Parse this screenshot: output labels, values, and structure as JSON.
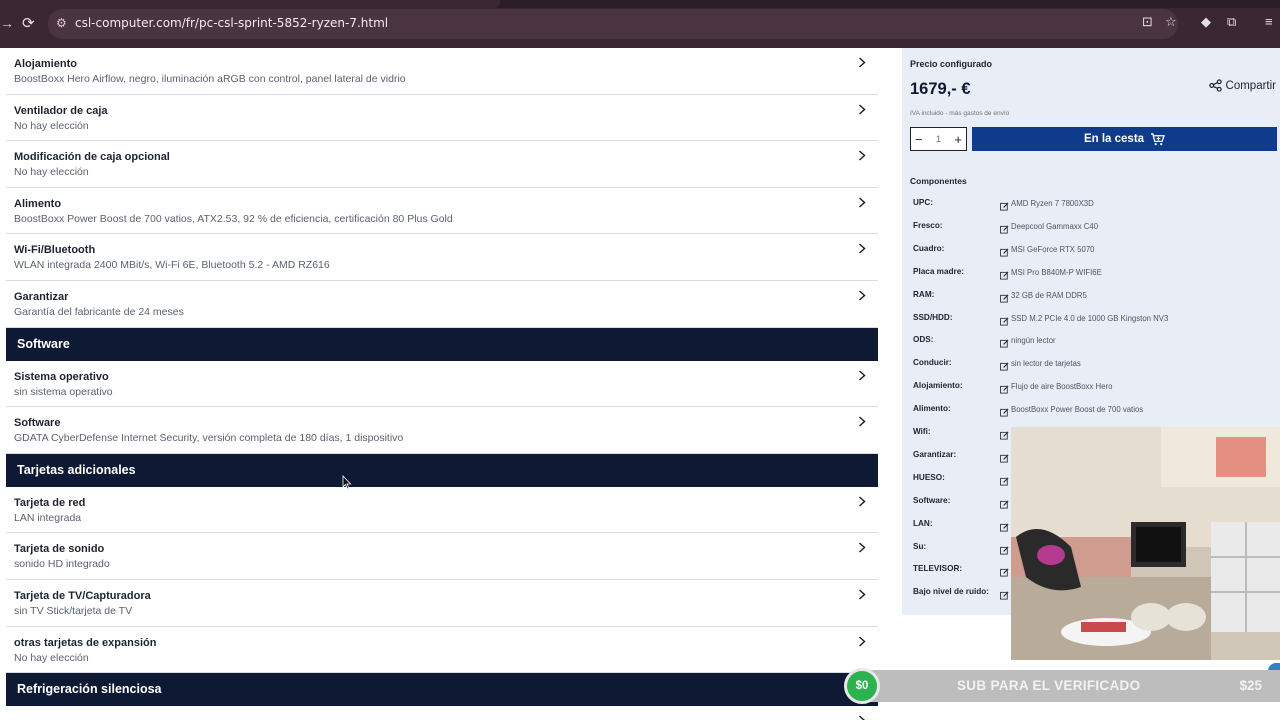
{
  "browser": {
    "url": "csl-computer.com/fr/pc-csl-sprint-5852-ryzen-7.html"
  },
  "sections": [
    {
      "heading": "",
      "rows": [
        {
          "title": "Alojamiento",
          "value": "BoostBoxx Hero Airflow, negro, iluminación aRGB con control, panel lateral de vidrio"
        },
        {
          "title": "Ventilador de caja",
          "value": "No hay elección"
        },
        {
          "title": "Modificación de caja opcional",
          "value": "No hay elección"
        },
        {
          "title": "Alimento",
          "value": "BoostBoxx Power Boost de 700 vatios, ATX2.53, 92 % de eficiencia, certificación 80 Plus Gold"
        },
        {
          "title": "Wi-Fi/Bluetooth",
          "value": "WLAN integrada 2400 MBit/s, Wi-Fi 6E, Bluetooth 5.2 - AMD RZ616"
        },
        {
          "title": "Garantizar",
          "value": "Garantía del fabricante de 24 meses"
        }
      ]
    },
    {
      "heading": "Software",
      "rows": [
        {
          "title": "Sistema operativo",
          "value": "sin sistema operativo"
        },
        {
          "title": "Software",
          "value": "GDATA CyberDefense Internet Security, versión completa de 180 días, 1 dispositivo"
        }
      ]
    },
    {
      "heading": "Tarjetas adicionales",
      "rows": [
        {
          "title": "Tarjeta de red",
          "value": "LAN integrada"
        },
        {
          "title": "Tarjeta de sonido",
          "value": "sonido HD integrado"
        },
        {
          "title": "Tarjeta de TV/Capturadora",
          "value": "sin TV Stick/tarjeta de TV"
        },
        {
          "title": "otras tarjetas de expansión",
          "value": "No hay elección"
        }
      ]
    },
    {
      "heading": "Refrigeración silenciosa",
      "rows": []
    }
  ],
  "panel": {
    "price_label": "Precio configurado",
    "price": "1679,- €",
    "vat_note": "IVA incluido - más gastos de envío",
    "share_label": "Compartir",
    "quantity": "1",
    "cart_label": "En la cesta",
    "components_title": "Componentes",
    "components": [
      {
        "key": "UPC:",
        "value": "AMD Ryzen 7 7800X3D"
      },
      {
        "key": "Fresco:",
        "value": "Deepcool Gammaxx C40"
      },
      {
        "key": "Cuadro:",
        "value": "MSI GeForce RTX 5070"
      },
      {
        "key": "Placa madre:",
        "value": "MSI Pro B840M-P WIFI6E"
      },
      {
        "key": "RAM:",
        "value": "32 GB de RAM DDR5"
      },
      {
        "key": "SSD/HDD:",
        "value": "SSD M.2 PCIe 4.0 de 1000 GB Kingston NV3"
      },
      {
        "key": "ODS:",
        "value": "ningún lector"
      },
      {
        "key": "Conducir:",
        "value": "sin lector de tarjetas"
      },
      {
        "key": "Alojamiento:",
        "value": "Flujo de aire BoostBoxx Hero"
      },
      {
        "key": "Alimento:",
        "value": "BoostBoxx Power Boost de 700 vatios"
      },
      {
        "key": "Wifi:",
        "value": ""
      },
      {
        "key": "Garantizar:",
        "value": ""
      },
      {
        "key": "HUESO:",
        "value": ""
      },
      {
        "key": "Software:",
        "value": ""
      },
      {
        "key": "LAN:",
        "value": ""
      },
      {
        "key": "Su:",
        "value": ""
      },
      {
        "key": "TELEVISOR:",
        "value": ""
      },
      {
        "key": "Bajo nivel de ruido:",
        "value": ""
      }
    ]
  },
  "stream_banner": {
    "coin": "$0",
    "text": "SUB PARA EL VERIFICADO",
    "amount": "$25"
  },
  "colors": {
    "section_bg": "#0e1a33",
    "cart_button": "#0f3b8c",
    "panel_bg": "#e9eef6",
    "banner_coin": "#2eb24f"
  }
}
